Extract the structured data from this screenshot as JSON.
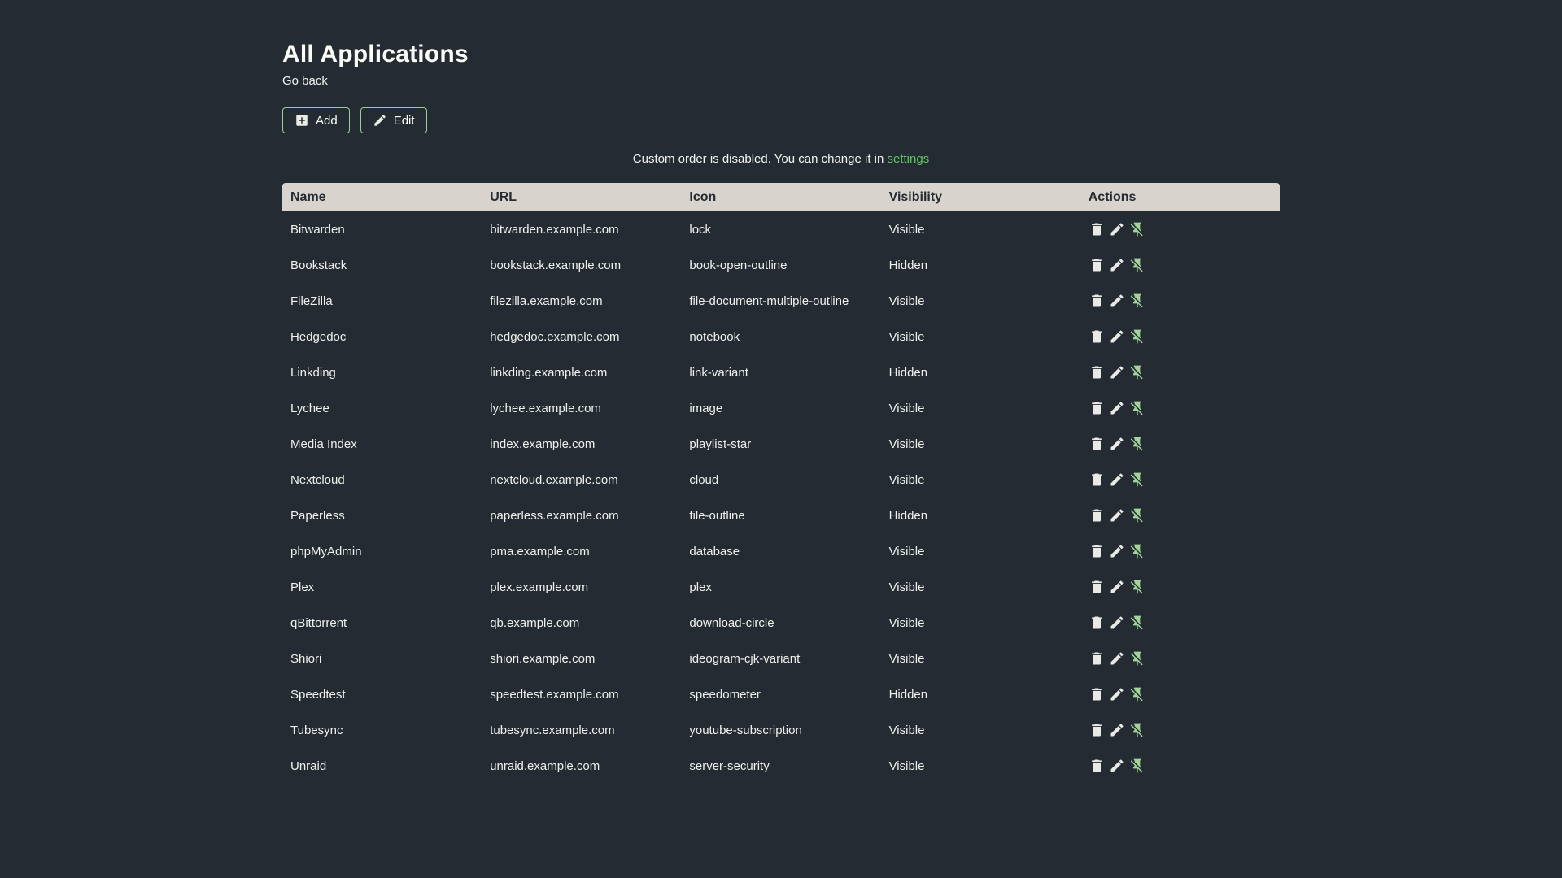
{
  "page": {
    "title": "All Applications",
    "back_link": "Go back",
    "buttons": {
      "add": "Add",
      "edit": "Edit"
    },
    "notice": {
      "text": "Custom order is disabled. You can change it in",
      "link": "settings"
    }
  },
  "colors": {
    "background": "#242b33",
    "accent_link_green": "#62c462",
    "button_border_green": "#9ccc97",
    "pin_icon_green": "#a2d49a",
    "table_header_bg": "#d8d4cd",
    "table_header_text": "#242b33",
    "body_text": "#eff0ec"
  },
  "icons": {
    "add_button": "plus-box-icon",
    "edit_button": "pencil-icon",
    "row_delete": "trash-icon",
    "row_edit": "pencil-icon",
    "row_unpin": "pin-off-icon"
  },
  "table": {
    "headers": [
      "Name",
      "URL",
      "Icon",
      "Visibility",
      "Actions"
    ],
    "rows": [
      {
        "name": "Bitwarden",
        "url": "bitwarden.example.com",
        "icon": "lock",
        "visibility": "Visible"
      },
      {
        "name": "Bookstack",
        "url": "bookstack.example.com",
        "icon": "book-open-outline",
        "visibility": "Hidden"
      },
      {
        "name": "FileZilla",
        "url": "filezilla.example.com",
        "icon": "file-document-multiple-outline",
        "visibility": "Visible"
      },
      {
        "name": "Hedgedoc",
        "url": "hedgedoc.example.com",
        "icon": "notebook",
        "visibility": "Visible"
      },
      {
        "name": "Linkding",
        "url": "linkding.example.com",
        "icon": "link-variant",
        "visibility": "Hidden"
      },
      {
        "name": "Lychee",
        "url": "lychee.example.com",
        "icon": "image",
        "visibility": "Visible"
      },
      {
        "name": "Media Index",
        "url": "index.example.com",
        "icon": "playlist-star",
        "visibility": "Visible"
      },
      {
        "name": "Nextcloud",
        "url": "nextcloud.example.com",
        "icon": "cloud",
        "visibility": "Visible"
      },
      {
        "name": "Paperless",
        "url": "paperless.example.com",
        "icon": "file-outline",
        "visibility": "Hidden"
      },
      {
        "name": "phpMyAdmin",
        "url": "pma.example.com",
        "icon": "database",
        "visibility": "Visible"
      },
      {
        "name": "Plex",
        "url": "plex.example.com",
        "icon": "plex",
        "visibility": "Visible"
      },
      {
        "name": "qBittorrent",
        "url": "qb.example.com",
        "icon": "download-circle",
        "visibility": "Visible"
      },
      {
        "name": "Shiori",
        "url": "shiori.example.com",
        "icon": "ideogram-cjk-variant",
        "visibility": "Visible"
      },
      {
        "name": "Speedtest",
        "url": "speedtest.example.com",
        "icon": "speedometer",
        "visibility": "Hidden"
      },
      {
        "name": "Tubesync",
        "url": "tubesync.example.com",
        "icon": "youtube-subscription",
        "visibility": "Visible"
      },
      {
        "name": "Unraid",
        "url": "unraid.example.com",
        "icon": "server-security",
        "visibility": "Visible"
      }
    ]
  }
}
